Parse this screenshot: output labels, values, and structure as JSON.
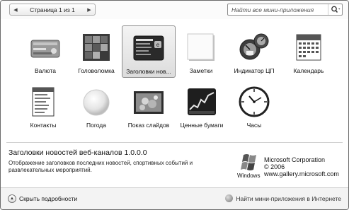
{
  "header": {
    "page_indicator": "Страница 1 из 1",
    "prev_arrow": "◀",
    "next_arrow": "▶",
    "search_placeholder": "Найти все мини-приложения"
  },
  "gadgets": [
    {
      "label": "Валюта",
      "icon": "currency-icon"
    },
    {
      "label": "Головоломка",
      "icon": "puzzle-icon"
    },
    {
      "label": "Заголовки нов...",
      "icon": "headlines-icon",
      "selected": true
    },
    {
      "label": "Заметки",
      "icon": "notes-icon"
    },
    {
      "label": "Индикатор ЦП",
      "icon": "cpu-meter-icon"
    },
    {
      "label": "Календарь",
      "icon": "calendar-icon"
    },
    {
      "label": "Контакты",
      "icon": "contacts-icon"
    },
    {
      "label": "Погода",
      "icon": "weather-icon"
    },
    {
      "label": "Показ слайдов",
      "icon": "slideshow-icon"
    },
    {
      "label": "Ценные бумаги",
      "icon": "stocks-icon"
    },
    {
      "label": "Часы",
      "icon": "clock-icon"
    }
  ],
  "details": {
    "title": "Заголовки новостей веб-каналов 1.0.0.0",
    "description": "Отображение заголовков последних новостей, спортивных событий и развлекательных мероприятий.",
    "windows_label": "Windows",
    "publisher": "Microsoft Corporation",
    "year": "© 2006",
    "website": "www.gallery.microsoft.com"
  },
  "footer": {
    "hide_details": "Скрыть подробности",
    "find_online": "Найти мини-приложения в Интернете"
  }
}
